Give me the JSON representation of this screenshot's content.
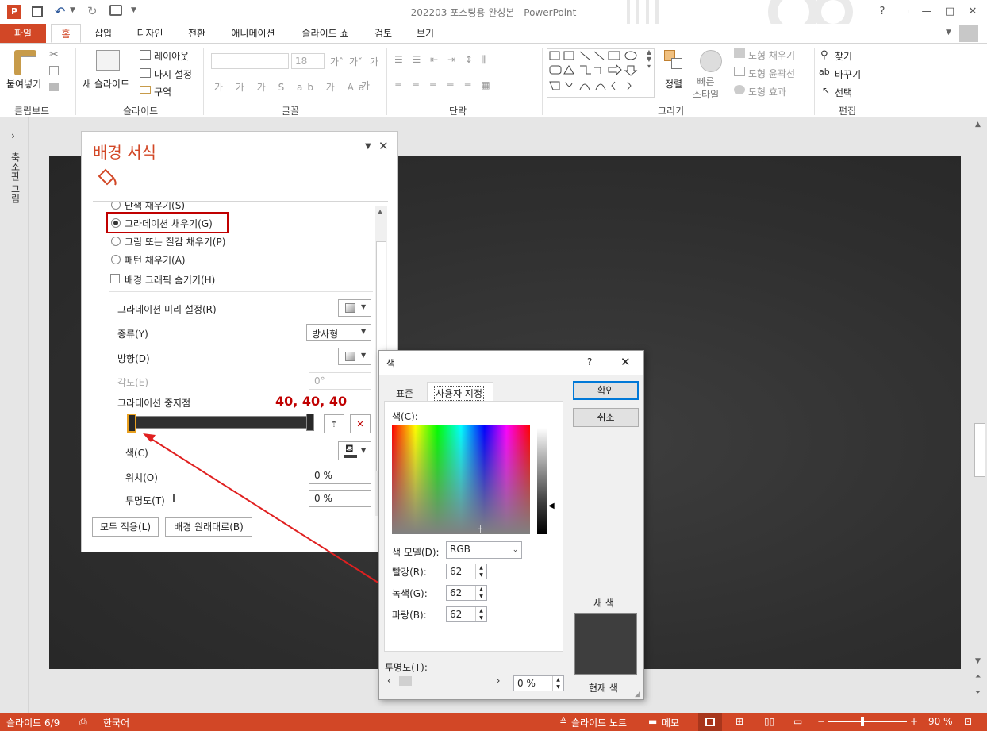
{
  "window": {
    "title": "202203 포스팅용 완성본 - PowerPoint",
    "help": "?"
  },
  "tabs": [
    "파일",
    "홈",
    "삽입",
    "디자인",
    "전환",
    "애니메이션",
    "슬라이드 쇼",
    "검토",
    "보기"
  ],
  "ribbon": {
    "clipboard": {
      "label": "클립보드",
      "paste": "붙여넣기"
    },
    "slides": {
      "label": "슬라이드",
      "new_slide": "새 슬라이드",
      "layout": "레이아웃",
      "reset": "다시 설정",
      "section": "구역"
    },
    "font": {
      "label": "글꼴",
      "size": "18"
    },
    "paragraph": {
      "label": "단락"
    },
    "drawing": {
      "label": "그리기",
      "arrange": "정렬",
      "quick_styles": "빠른\n스타일",
      "shape_fill": "도형 채우기",
      "shape_outline": "도형 윤곽선",
      "shape_effect": "도형 효과"
    },
    "editing": {
      "label": "편집",
      "find": "찾기",
      "replace": "바꾸기",
      "select": "선택"
    }
  },
  "left_panel": {
    "label": "축소판 그림"
  },
  "pane": {
    "title": "배경 서식",
    "fill_options": {
      "solid_partial": "단색 채우기(S)",
      "gradient": "그라데이션 채우기(G)",
      "picture": "그림 또는 질감 채우기(P)",
      "pattern": "패턴 채우기(A)",
      "hide_graphics": "배경 그래픽 숨기기(H)"
    },
    "preset_label": "그라데이션 미리 설정(R)",
    "type_label": "종류(Y)",
    "type_value": "방사형",
    "direction_label": "방향(D)",
    "angle_label": "각도(E)",
    "angle_value": "0°",
    "stops_label": "그라데이션 중지점",
    "annotation": "40, 40, 40",
    "color_label": "색(C)",
    "position_label": "위치(O)",
    "position_value": "0 %",
    "transparency_label": "투명도(T)",
    "transparency_value": "0 %",
    "apply_all": "모두 적용(L)",
    "reset_bg": "배경 원래대로(B)"
  },
  "color_dialog": {
    "title": "색",
    "help": "?",
    "tab_standard": "표준",
    "tab_custom": "사용자 지정",
    "colors_label": "색(C):",
    "model_label": "색 모델(D):",
    "model_value": "RGB",
    "red_label": "빨강(R):",
    "red": "62",
    "green_label": "녹색(G):",
    "green": "62",
    "blue_label": "파랑(B):",
    "blue": "62",
    "transparency_label": "투명도(T):",
    "transparency": "0 %",
    "ok": "확인",
    "cancel": "취소",
    "new_label": "새 색",
    "current_label": "현재 색"
  },
  "status": {
    "slide": "슬라이드 6/9",
    "language": "한국어",
    "notes": "슬라이드 노트",
    "comments": "메모",
    "zoom": "90 %"
  },
  "colors": {
    "accent": "#d24726",
    "highlight": "#c00000",
    "annotation": "#c00000",
    "swatch": "#3e3e3e"
  }
}
